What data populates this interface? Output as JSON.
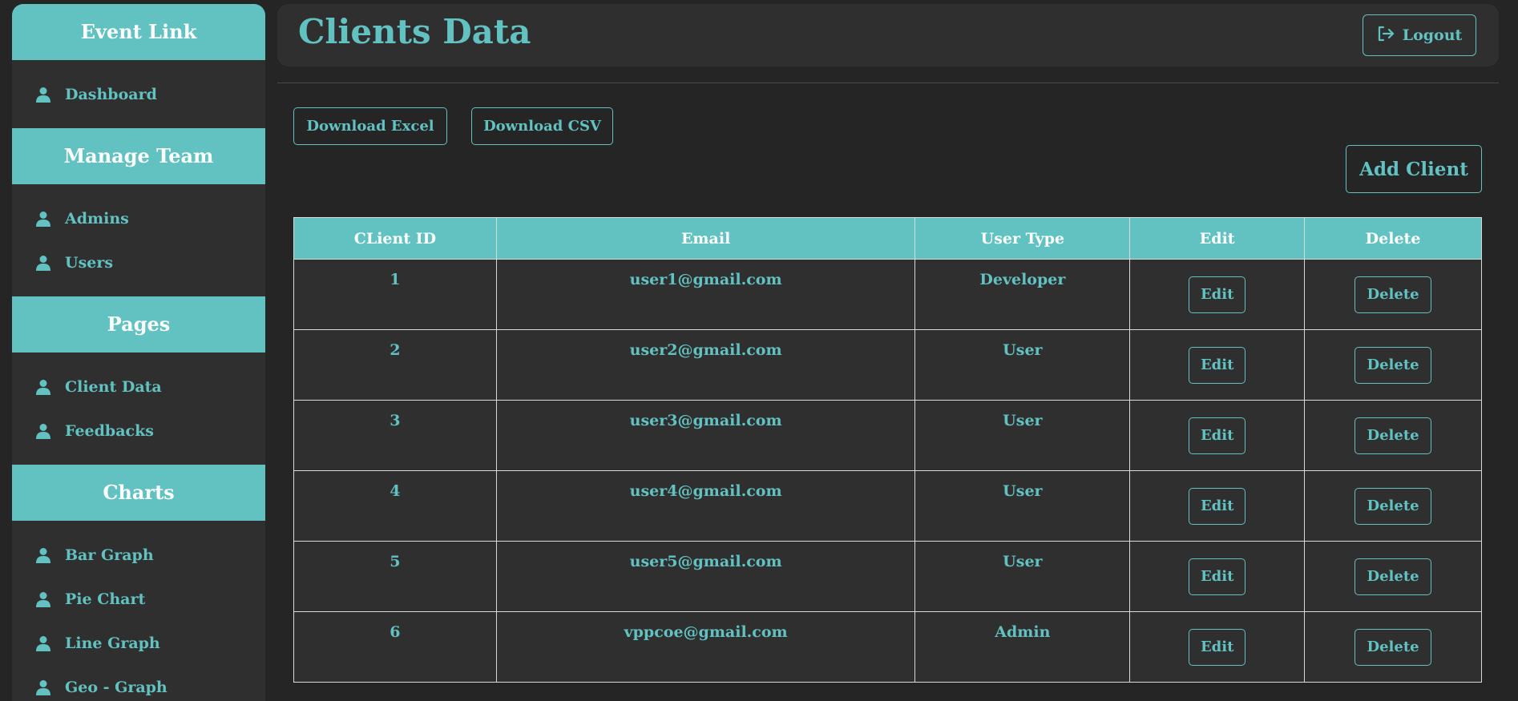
{
  "sidebar": {
    "brand": "Event Link",
    "dashboard": "Dashboard",
    "sections": [
      {
        "title": "Manage Team",
        "items": [
          "Admins",
          "Users"
        ]
      },
      {
        "title": "Pages",
        "items": [
          "Client Data",
          "Feedbacks"
        ]
      },
      {
        "title": "Charts",
        "items": [
          "Bar Graph",
          "Pie Chart",
          "Line Graph",
          "Geo - Graph"
        ]
      }
    ]
  },
  "header": {
    "title": "Clients Data",
    "logout_label": "Logout",
    "logout_icon": "logout-icon"
  },
  "toolbar": {
    "download_excel": "Download Excel",
    "download_csv": "Download CSV",
    "add_client": "Add Client"
  },
  "table": {
    "columns": [
      "CLient ID",
      "Email",
      "User Type",
      "Edit",
      "Delete"
    ],
    "rows": [
      {
        "id": "1",
        "email": "user1@gmail.com",
        "type": "Developer"
      },
      {
        "id": "2",
        "email": "user2@gmail.com",
        "type": "User"
      },
      {
        "id": "3",
        "email": "user3@gmail.com",
        "type": "User"
      },
      {
        "id": "4",
        "email": "user4@gmail.com",
        "type": "User"
      },
      {
        "id": "5",
        "email": "user5@gmail.com",
        "type": "User"
      },
      {
        "id": "6",
        "email": "vppcoe@gmail.com",
        "type": "Admin"
      }
    ],
    "edit_label": "Edit",
    "delete_label": "Delete"
  },
  "colors": {
    "accent": "#62c2c1",
    "background": "#252525",
    "panel": "#2f2f2f"
  }
}
